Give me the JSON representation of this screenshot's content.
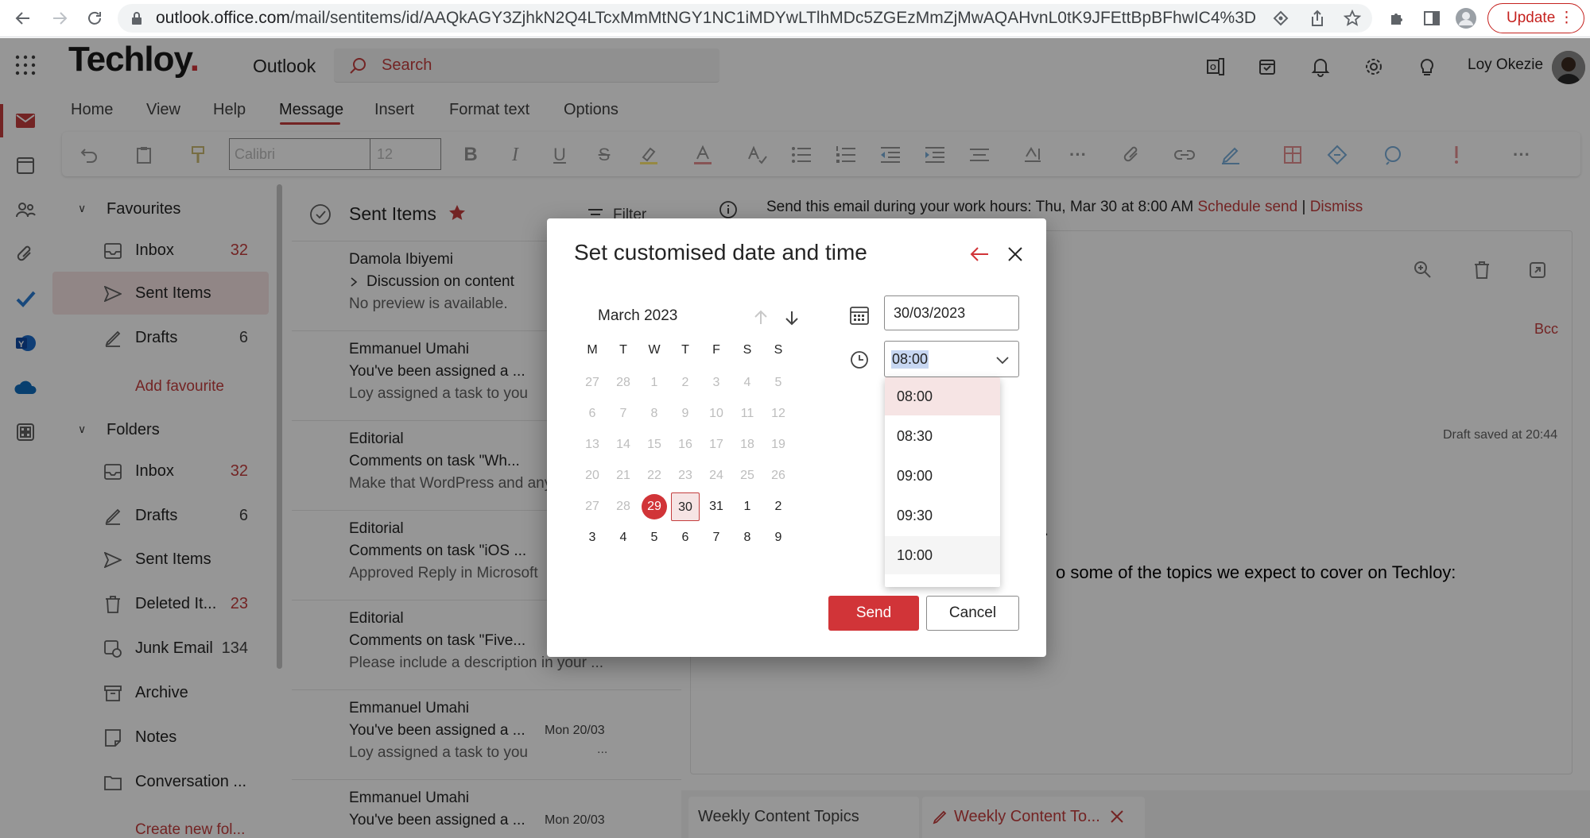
{
  "browser": {
    "url_host": "outlook.office.com",
    "url_path": "/mail/sentitems/id/AAQkAGY3ZjhkN2Q4LTcxMmMtNGY1NC1iMDYwLTlhMDc5ZGEzMmZjMwAQAHvnL0tK9JFEttBpBFhwIC4%3D",
    "update_label": "Update"
  },
  "app": {
    "logo": "Techloy",
    "logo_dot": ".",
    "name": "Outlook",
    "search_placeholder": "Search",
    "user_name": "Loy Okezie",
    "accent": "#c43e3e"
  },
  "ribbon": {
    "tabs": [
      "Home",
      "View",
      "Help",
      "Message",
      "Insert",
      "Format text",
      "Options"
    ],
    "active_tab": "Message",
    "font_name": "Calibri",
    "font_size": "12"
  },
  "folders": {
    "favourites_label": "Favourites",
    "favourites": [
      {
        "label": "Inbox",
        "count": "32",
        "count_red": true,
        "icon": "inbox-icon"
      },
      {
        "label": "Sent Items",
        "count": "",
        "selected": true,
        "icon": "send-icon"
      },
      {
        "label": "Drafts",
        "count": "6",
        "icon": "draft-icon"
      }
    ],
    "add_favourite": "Add favourite",
    "folders_label": "Folders",
    "folders": [
      {
        "label": "Inbox",
        "count": "32",
        "count_red": true,
        "icon": "inbox-icon"
      },
      {
        "label": "Drafts",
        "count": "6",
        "icon": "draft-icon"
      },
      {
        "label": "Sent Items",
        "count": "",
        "icon": "send-icon"
      },
      {
        "label": "Deleted It...",
        "count": "23",
        "count_red": true,
        "icon": "trash-icon"
      },
      {
        "label": "Junk Email",
        "count": "134",
        "icon": "junk-icon"
      },
      {
        "label": "Archive",
        "count": "",
        "icon": "archive-icon"
      },
      {
        "label": "Notes",
        "count": "",
        "icon": "note-icon"
      },
      {
        "label": "Conversation ...",
        "count": "",
        "icon": "folder-icon"
      }
    ],
    "create_new": "Create new fol..."
  },
  "message_list": {
    "title": "Sent Items",
    "filter_label": "Filter",
    "messages": [
      {
        "sender": "Damola Ibiyemi",
        "subject": "Discussion on content",
        "preview": "No preview is available.",
        "date": "",
        "thread": true
      },
      {
        "sender": "Emmanuel Umahi",
        "subject": "You've been assigned a ...",
        "preview": "Loy assigned a task to you",
        "date": ""
      },
      {
        "sender": "Editorial",
        "subject": "Comments on task \"Wh...",
        "preview": "Make that WordPress and any",
        "date": ""
      },
      {
        "sender": "Editorial",
        "subject": "Comments on task \"iOS ...",
        "preview": "Approved Reply in Microsoft",
        "date": ""
      },
      {
        "sender": "Editorial",
        "subject": "Comments on task \"Five...",
        "preview": "Please include a description in your ...",
        "date": ""
      },
      {
        "sender": "Emmanuel Umahi",
        "subject": "You've been assigned a ...",
        "preview": "Loy assigned a task to you",
        "date": "Mon 20/03",
        "dots": "..."
      },
      {
        "sender": "Emmanuel Umahi",
        "subject": "You've been assigned a ...",
        "preview": "",
        "date": "Mon 20/03"
      }
    ]
  },
  "reading": {
    "info_text": "Send this email during your work hours: Thu, Mar 30 at 8:00 AM",
    "schedule_send": "Schedule send",
    "separator": "|",
    "dismiss": "Dismiss",
    "bcc": "Bcc",
    "draft_saved": "Draft saved at 20:44",
    "body_dot": ".",
    "body_text": "o some of the topics we expect to cover on Techloy:",
    "bottom_tabs": [
      "Weekly Content Topics",
      "Weekly Content To..."
    ]
  },
  "dialog": {
    "title": "Set customised date and time",
    "month_label": "March 2023",
    "weekdays": [
      "M",
      "T",
      "W",
      "T",
      "F",
      "S",
      "S"
    ],
    "weeks": [
      [
        "27",
        "28",
        "1",
        "2",
        "3",
        "4",
        "5"
      ],
      [
        "6",
        "7",
        "8",
        "9",
        "10",
        "11",
        "12"
      ],
      [
        "13",
        "14",
        "15",
        "16",
        "17",
        "18",
        "19"
      ],
      [
        "20",
        "21",
        "22",
        "23",
        "24",
        "25",
        "26"
      ],
      [
        "27",
        "28",
        "29",
        "30",
        "31",
        "1",
        "2"
      ],
      [
        "3",
        "4",
        "5",
        "6",
        "7",
        "8",
        "9"
      ]
    ],
    "today": "29",
    "selected_day": "30",
    "date_value": "30/03/2023",
    "time_value": "08:00",
    "time_options": [
      "08:00",
      "08:30",
      "09:00",
      "09:30",
      "10:00"
    ],
    "send_label": "Send",
    "cancel_label": "Cancel"
  }
}
